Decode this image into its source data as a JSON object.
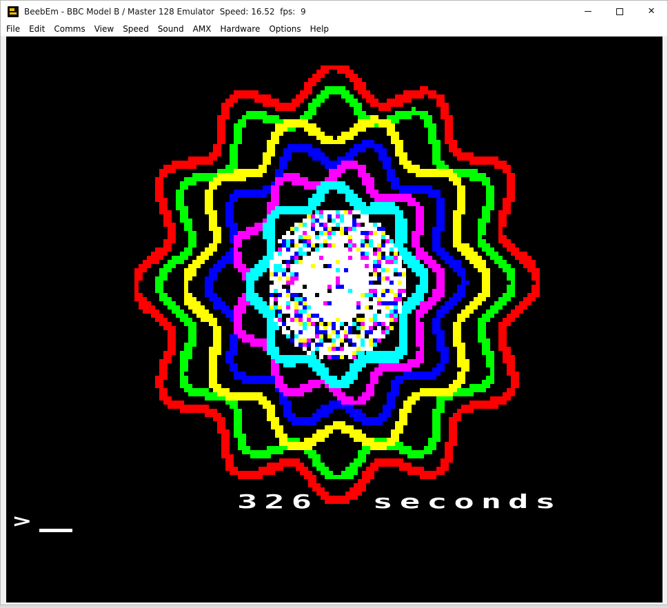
{
  "window": {
    "title": "BeebEm - BBC Model B / Master 128 Emulator  Speed: 16.52  fps:  9",
    "icon": "beebem-app-icon"
  },
  "menu": {
    "items": [
      "File",
      "Edit",
      "Comms",
      "View",
      "Speed",
      "Sound",
      "AMX",
      "Hardware",
      "Options",
      "Help"
    ]
  },
  "screen": {
    "timer_text": "326  seconds",
    "prompt": ">",
    "colors": {
      "background": "#000000",
      "red": "#ff0000",
      "green": "#00ff00",
      "yellow": "#ffff00",
      "blue": "#0000ff",
      "magenta": "#ff00ff",
      "cyan": "#00ffff",
      "white": "#ffffff"
    }
  }
}
